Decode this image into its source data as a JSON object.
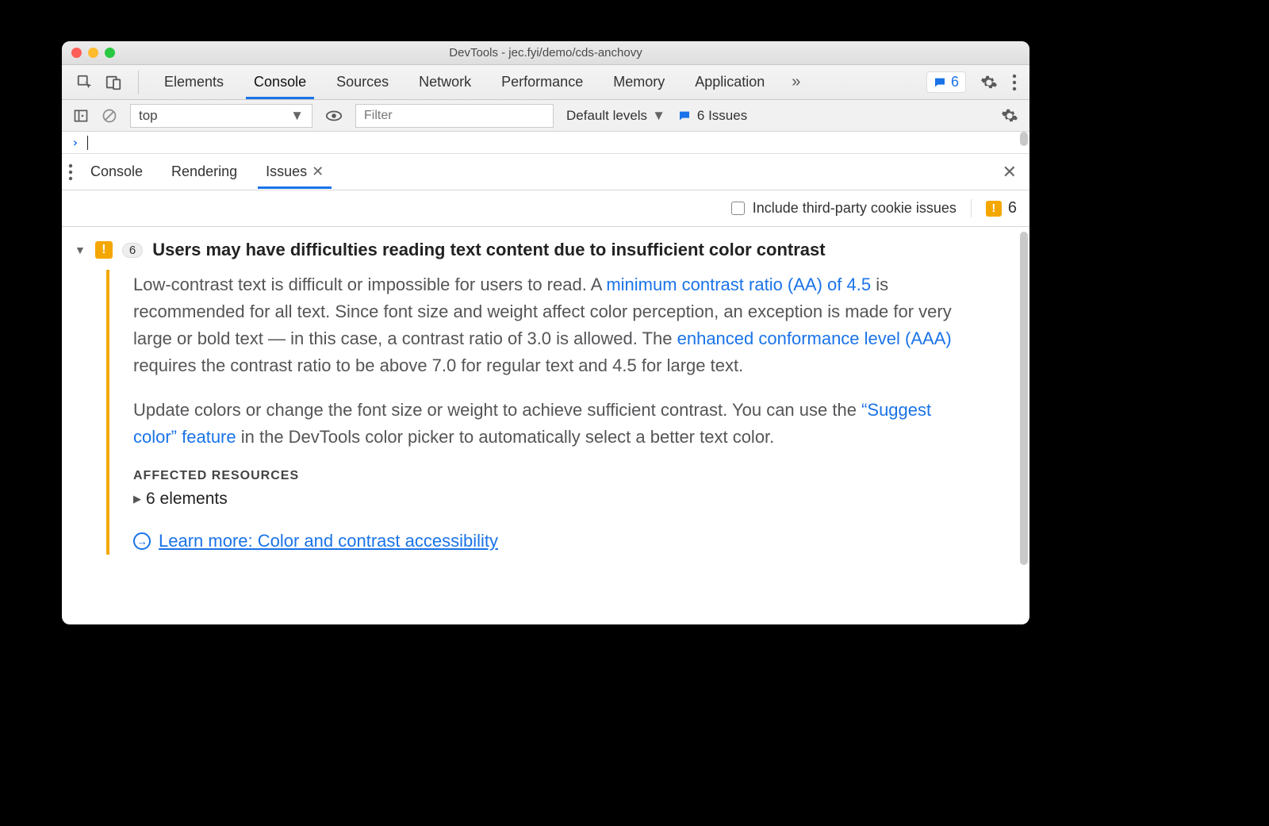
{
  "window": {
    "title": "DevTools - jec.fyi/demo/cds-anchovy"
  },
  "mainTabs": {
    "items": [
      "Elements",
      "Console",
      "Sources",
      "Network",
      "Performance",
      "Memory",
      "Application"
    ],
    "activeIndex": 1,
    "issueBadgeCount": "6"
  },
  "consoleBar": {
    "context": "top",
    "filterPlaceholder": "Filter",
    "levels": "Default levels",
    "issuesLink": "6 Issues"
  },
  "drawer": {
    "tabs": [
      "Console",
      "Rendering",
      "Issues"
    ],
    "activeIndex": 2,
    "includeThirdParty": "Include third-party cookie issues",
    "issueCount": "6"
  },
  "issue": {
    "count": "6",
    "title": "Users may have difficulties reading text content due to insufficient color contrast",
    "p1a": "Low-contrast text is difficult or impossible for users to read. A ",
    "link1": "minimum contrast ratio (AA) of 4.5",
    "p1b": " is recommended for all text. Since font size and weight affect color perception, an exception is made for very large or bold text — in this case, a contrast ratio of 3.0 is allowed. The ",
    "link2": "enhanced conformance level (AAA)",
    "p1c": " requires the contrast ratio to be above 7.0 for regular text and 4.5 for large text.",
    "p2a": "Update colors or change the font size or weight to achieve sufficient contrast. You can use the ",
    "link3": "“Suggest color” feature",
    "p2b": " in the DevTools color picker to automatically select a better text color.",
    "affectedHeading": "AFFECTED RESOURCES",
    "affectedElements": "6 elements",
    "learnMore": "Learn more: Color and contrast accessibility"
  }
}
